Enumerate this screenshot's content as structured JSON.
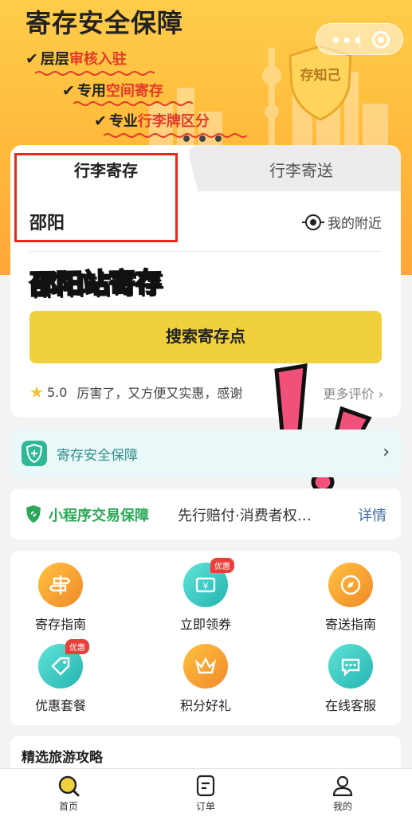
{
  "banner": {
    "title": "寄存安全保障",
    "bullets": [
      {
        "plain": "层层",
        "red": "审核入驻"
      },
      {
        "plain": "专用",
        "red": "空间寄存"
      },
      {
        "plain": "专业",
        "red": "行李牌区分"
      }
    ],
    "shield_text": "存知己"
  },
  "capsule": {
    "more_icon": "more-dots-icon",
    "close_icon": "target-circle-icon"
  },
  "card": {
    "tabs": [
      "行李寄存",
      "行李寄送"
    ],
    "city": "邵阳",
    "nearby": "我的附近",
    "station": "邵阳站寄存",
    "search_button": "搜索寄存点",
    "review": {
      "score": "5.0",
      "text": "厉害了，又方便又实惠，感谢",
      "more": "更多评价"
    }
  },
  "safety": {
    "label": "寄存安全保障"
  },
  "trade": {
    "name": "小程序交易保障",
    "desc": "先行赔付·消费者权…",
    "detail": "详情"
  },
  "services": [
    {
      "label": "寄存指南",
      "badge": "",
      "color": "orange",
      "icon": "signpost-icon"
    },
    {
      "label": "立即领券",
      "badge": "优惠",
      "color": "teal",
      "icon": "coupon-icon"
    },
    {
      "label": "寄送指南",
      "badge": "",
      "color": "orange",
      "icon": "compass-icon"
    },
    {
      "label": "优惠套餐",
      "badge": "优惠",
      "color": "teal",
      "icon": "tag-icon"
    },
    {
      "label": "积分好礼",
      "badge": "",
      "color": "orange",
      "icon": "crown-icon"
    },
    {
      "label": "在线客服",
      "badge": "",
      "color": "teal",
      "icon": "chat-icon"
    }
  ],
  "guides": {
    "title": "精选旅游攻略"
  },
  "tabbar": [
    "首页",
    "订单",
    "我的"
  ]
}
